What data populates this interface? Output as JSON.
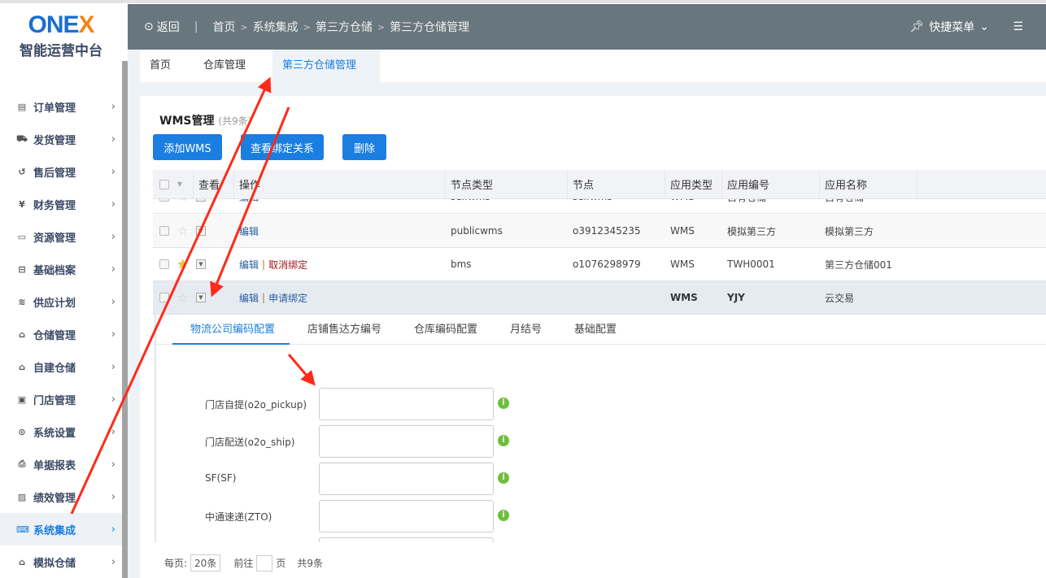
{
  "brand": {
    "logo_text": "ONEX",
    "subtitle": "智能运营中台"
  },
  "sidebar": {
    "items": [
      {
        "label": "订单管理",
        "icon": "order-icon"
      },
      {
        "label": "发货管理",
        "icon": "truck-icon"
      },
      {
        "label": "售后管理",
        "icon": "return-icon"
      },
      {
        "label": "财务管理",
        "icon": "yen-icon"
      },
      {
        "label": "资源管理",
        "icon": "resource-icon"
      },
      {
        "label": "基础档案",
        "icon": "archive-icon"
      },
      {
        "label": "供应计划",
        "icon": "plan-icon"
      },
      {
        "label": "仓储管理",
        "icon": "warehouse-icon"
      },
      {
        "label": "自建仓储",
        "icon": "home-plus-icon"
      },
      {
        "label": "门店管理",
        "icon": "store-icon"
      },
      {
        "label": "系统设置",
        "icon": "settings-icon"
      },
      {
        "label": "单据报表",
        "icon": "printer-icon"
      },
      {
        "label": "绩效管理",
        "icon": "kpi-icon"
      },
      {
        "label": "系统集成",
        "icon": "code-icon",
        "active": true
      },
      {
        "label": "模拟仓储",
        "icon": "sim-warehouse-icon"
      }
    ]
  },
  "header": {
    "back": "返回",
    "breadcrumb": [
      "首页",
      "系统集成",
      "第三方仓储",
      "第三方仓储管理"
    ],
    "quick_menu": "快捷菜单"
  },
  "tabs": [
    {
      "label": "首页"
    },
    {
      "label": "仓库管理"
    },
    {
      "label": "第三方仓储管理",
      "close": "×"
    }
  ],
  "main": {
    "title": "WMS管理",
    "count": "(共9条)",
    "buttons": {
      "add": "添加WMS",
      "view_bind": "查看绑定关系",
      "delete": "删除"
    },
    "columns": [
      "查看",
      "操作",
      "节点类型",
      "节点",
      "应用类型",
      "应用编号",
      "应用名称"
    ],
    "rows": [
      {
        "ops": [
          "编辑"
        ],
        "node_type": "selfwms",
        "node": "selfwms",
        "app_type": "WMS",
        "app_code": "自有仓储",
        "app_name": "自有仓储",
        "starred": false
      },
      {
        "ops": [
          "编辑"
        ],
        "node_type": "publicwms",
        "node": "o3912345235",
        "app_type": "WMS",
        "app_code": "模拟第三方",
        "app_name": "模拟第三方",
        "starred": false
      },
      {
        "ops": [
          "编辑",
          "取消绑定"
        ],
        "node_type": "bms",
        "node": "o1076298979",
        "app_type": "WMS",
        "app_code": "TWH0001",
        "app_name": "第三方仓储001",
        "starred": true
      },
      {
        "ops": [
          "编辑",
          "申请绑定"
        ],
        "node_type": "",
        "node": "",
        "app_type": "WMS",
        "app_code": "YJY",
        "app_name": "云交易",
        "starred": false
      }
    ]
  },
  "detail": {
    "tabs": [
      "物流公司编码配置",
      "店铺售达方编号",
      "仓库编码配置",
      "月结号",
      "基础配置"
    ],
    "fields": [
      {
        "label": "门店自提(o2o_pickup)",
        "value": ""
      },
      {
        "label": "门店配送(o2o_ship)",
        "value": ""
      },
      {
        "label": "SF(SF)",
        "value": ""
      },
      {
        "label": "中通速递(ZTO)",
        "value": ""
      }
    ]
  },
  "footer": {
    "per_page_label": "每页:",
    "per_page": "20条",
    "goto": "前往",
    "page_unit": "页",
    "total": "共9条"
  },
  "colors": {
    "accent": "#1a7fe0",
    "header": "#68767d",
    "annotation": "#ff2a1a"
  }
}
